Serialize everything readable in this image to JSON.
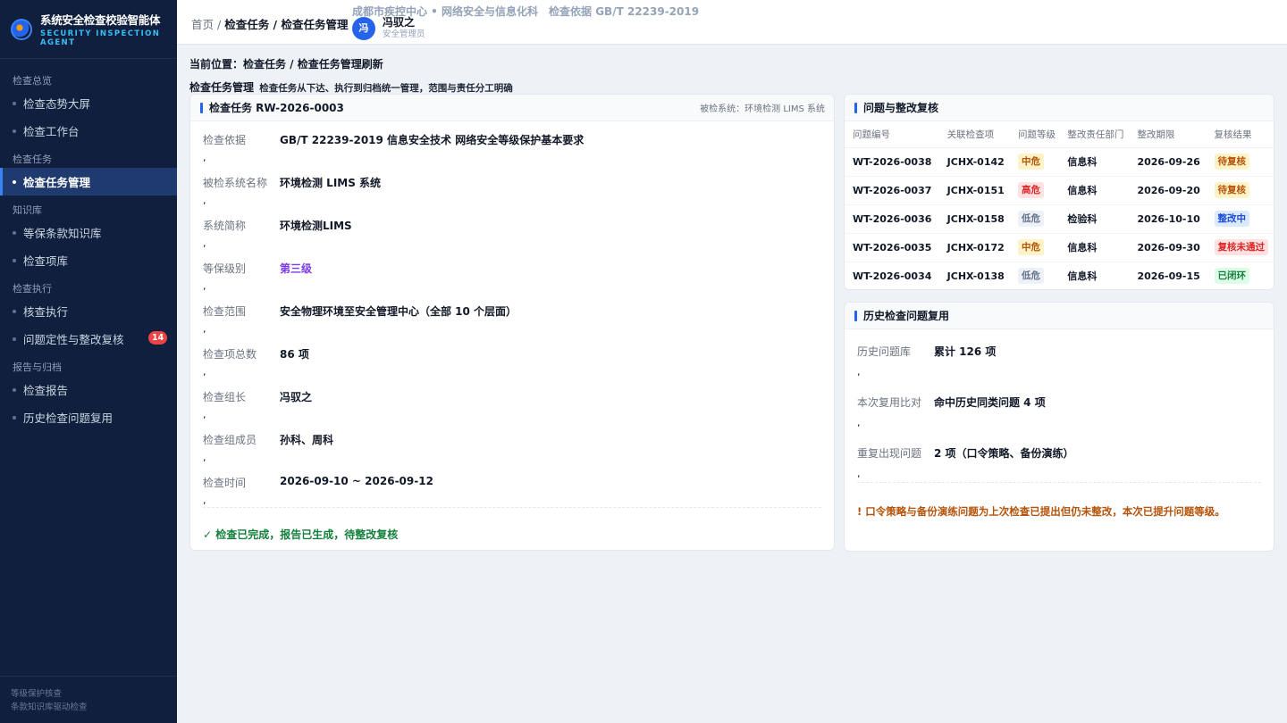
{
  "brand": {
    "title": "系统安全检查校验智能体",
    "subtitle_line1": "SECURITY INSPECTION",
    "subtitle_line2": "AGENT"
  },
  "sidebar": {
    "sections": [
      {
        "label": "检查总览",
        "items": [
          {
            "label": "检查态势大屏"
          },
          {
            "label": "检查工作台"
          }
        ]
      },
      {
        "label": "检查任务",
        "items": [
          {
            "label": "检查任务管理",
            "active": true
          }
        ]
      },
      {
        "label": "知识库",
        "items": [
          {
            "label": "等保条款知识库"
          },
          {
            "label": "检查项库"
          }
        ]
      },
      {
        "label": "检查执行",
        "items": [
          {
            "label": "核查执行"
          },
          {
            "label": "问题定性与整改复核",
            "badge": "14"
          }
        ]
      },
      {
        "label": "报告与归档",
        "items": [
          {
            "label": "检查报告"
          },
          {
            "label": "历史检查问题复用"
          }
        ]
      }
    ],
    "footer_line1": "等级保护核查",
    "footer_line2": "条款知识库驱动检查"
  },
  "header": {
    "crumb_home": "首页",
    "crumb_sep": "/",
    "crumb_current": "检查任务 / 检查任务管理",
    "org": "成都市疾控中心 • 网络安全与信息化科",
    "basis": "检查依据 GB/T 22239-2019",
    "user_avatar": "冯",
    "user_name": "冯驭之",
    "user_role": "安全管理员"
  },
  "main": {
    "location": "当前位置：检查任务 / 检查任务管理刷新",
    "page_title": "检查任务管理",
    "page_desc": "检查任务从下达、执行到归档统一管理，范围与责任分工明确"
  },
  "task": {
    "title": "检查任务 RW-2026-0003",
    "system_note": "被检系统：环境检测 LIMS 系统",
    "fields": [
      {
        "k": "检查依据",
        "v": "GB/T 22239-2019 信息安全技术 网络安全等级保护基本要求"
      },
      {
        "k": "被检系统名称",
        "v": "环境检测 LIMS 系统"
      },
      {
        "k": "系统简称",
        "v": "环境检测LIMS"
      },
      {
        "k": "等保级别",
        "v": "第三级"
      },
      {
        "k": "检查范围",
        "v": "安全物理环境至安全管理中心（全部 10 个层面）"
      },
      {
        "k": "检查项总数",
        "v": "86 项"
      },
      {
        "k": "检查组长",
        "v": "冯驭之"
      },
      {
        "k": "检查组成员",
        "v": "孙科、周科"
      },
      {
        "k": "检查时间",
        "v": "2026-09-10 ~ 2026-09-12"
      }
    ],
    "separator": ",",
    "status_note": "✓ 检查已完成，报告已生成，待整改复核"
  },
  "issues": {
    "title": "问题与整改复核",
    "columns": [
      "问题编号",
      "关联检查项",
      "问题等级",
      "整改责任部门",
      "整改期限",
      "复核结果"
    ],
    "rows": [
      {
        "id": "WT-2026-0038",
        "item": "JCHX-0142",
        "level": "中危",
        "dept": "信息科",
        "deadline": "2026-09-26",
        "result": "待复核"
      },
      {
        "id": "WT-2026-0037",
        "item": "JCHX-0151",
        "level": "高危",
        "dept": "信息科",
        "deadline": "2026-09-20",
        "result": "待复核"
      },
      {
        "id": "WT-2026-0036",
        "item": "JCHX-0158",
        "level": "低危",
        "dept": "检验科",
        "deadline": "2026-10-10",
        "result": "整改中"
      },
      {
        "id": "WT-2026-0035",
        "item": "JCHX-0172",
        "level": "中危",
        "dept": "信息科",
        "deadline": "2026-09-30",
        "result": "复核未通过"
      },
      {
        "id": "WT-2026-0034",
        "item": "JCHX-0138",
        "level": "低危",
        "dept": "信息科",
        "deadline": "2026-09-15",
        "result": "已闭环"
      }
    ]
  },
  "history": {
    "title": "历史检查问题复用",
    "fields": [
      {
        "k": "历史问题库",
        "v": "累计 126 项"
      },
      {
        "k": "本次复用比对",
        "v": "命中历史同类问题 4 项"
      },
      {
        "k": "重复出现问题",
        "v": "2 项（口令策略、备份演练）"
      }
    ],
    "separator": ",",
    "warning": "! 口令策略与备份演练问题为上次检查已提出但仍未整改，本次已提升问题等级。"
  },
  "colors": {
    "sidebar_bg": "#0f1f3d",
    "accent": "#2563eb",
    "success": "#15803d",
    "warning": "#b45309",
    "danger": "#dc2626"
  }
}
